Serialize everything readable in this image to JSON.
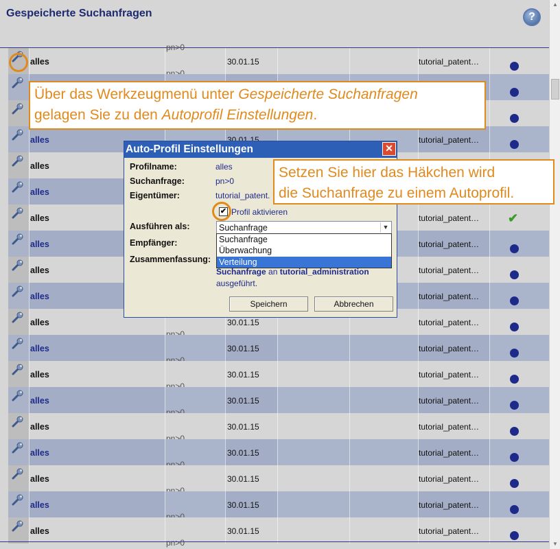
{
  "page": {
    "title": "Gespeicherte Suchanfragen",
    "help": "?"
  },
  "previous_row_fragment": "pn>0",
  "rows": [
    {
      "name": "alles",
      "query": "pn>0",
      "date": "30.01.15",
      "owner": "tutorial_patent…",
      "status": "dot"
    },
    {
      "name": "alles",
      "query": "pn>0",
      "date": "30.01.15",
      "owner": "tutorial_patent…",
      "status": "dot"
    },
    {
      "name": "alles",
      "query": "pn>0",
      "date": "30.01.15",
      "owner": "tutorial_patent…",
      "status": "dot"
    },
    {
      "name": "alles",
      "query": "pn>0",
      "date": "30.01.15",
      "owner": "tutorial_patent…",
      "status": "dot"
    },
    {
      "name": "alles",
      "query": "pn>0",
      "date": "30.01.15",
      "owner": "tutorial_patent…",
      "status": "dot"
    },
    {
      "name": "alles",
      "query": "pn>0",
      "date": "30.01.15",
      "owner": "tutorial_patent…",
      "status": "dot"
    },
    {
      "name": "alles",
      "query": "pn>0",
      "date": "30.01.15",
      "owner": "tutorial_patent…",
      "status": "check"
    },
    {
      "name": "alles",
      "query": "pn>0",
      "date": "30.01.15",
      "owner": "tutorial_patent…",
      "status": "dot"
    },
    {
      "name": "alles",
      "query": "pn>0",
      "date": "30.01.15",
      "owner": "tutorial_patent…",
      "status": "dot"
    },
    {
      "name": "alles",
      "query": "pn>0",
      "date": "30.01.15",
      "owner": "tutorial_patent…",
      "status": "dot"
    },
    {
      "name": "alles",
      "query": "pn>0",
      "date": "30.01.15",
      "owner": "tutorial_patent…",
      "status": "dot"
    },
    {
      "name": "alles",
      "query": "pn>0",
      "date": "30.01.15",
      "owner": "tutorial_patent…",
      "status": "dot"
    },
    {
      "name": "alles",
      "query": "pn>0",
      "date": "30.01.15",
      "owner": "tutorial_patent…",
      "status": "dot"
    },
    {
      "name": "alles",
      "query": "pn>0",
      "date": "30.01.15",
      "owner": "tutorial_patent…",
      "status": "dot"
    },
    {
      "name": "alles",
      "query": "pn>0",
      "date": "30.01.15",
      "owner": "tutorial_patent…",
      "status": "dot"
    },
    {
      "name": "alles",
      "query": "pn>0",
      "date": "30.01.15",
      "owner": "tutorial_patent…",
      "status": "dot"
    },
    {
      "name": "alles",
      "query": "pn>0",
      "date": "30.01.15",
      "owner": "tutorial_patent…",
      "status": "dot"
    },
    {
      "name": "alles",
      "query": "pn>0",
      "date": "30.01.15",
      "owner": "tutorial_patent…",
      "status": "dot"
    },
    {
      "name": "alles",
      "query": "pn>0",
      "date": "30.01.15",
      "owner": "tutorial_patent…",
      "status": "dot"
    }
  ],
  "callouts": {
    "toolmenu": {
      "part1": "Über das Werkzeugmenü unter ",
      "part2": "Gespeicherte Suchanfragen",
      "part3": "gelagen Sie zu den ",
      "part4": "Autoprofil Einstellungen",
      "part5": "."
    },
    "checkbox": {
      "line1": "Setzen Sie hier das Häkchen wird",
      "line2": "die Suchanfrage zu einem Autoprofil."
    }
  },
  "dialog": {
    "title": "Auto-Profil Einstellungen",
    "close": "✕",
    "fields": {
      "profilname_label": "Profilname:",
      "profilname_value": "alles",
      "suchanfrage_label": "Suchanfrage:",
      "suchanfrage_value": "pn>0",
      "eigentuemer_label": "Eigentümer:",
      "eigentuemer_value": "tutorial_patent.",
      "ausfuehren_label": "Ausführen als:",
      "empfaenger_label": "Empfänger:",
      "zusammenfassung_label": "Zusammenfassung:"
    },
    "checkbox": {
      "label": "Profil aktivieren",
      "checked": true,
      "mark": "✔"
    },
    "select": {
      "value": "Suchanfrage",
      "arrow": "▼",
      "options": [
        "Suchanfrage",
        "Überwachung",
        "Verteilung"
      ],
      "highlighted": "Verteilung"
    },
    "summary": {
      "bold1": "Suchanfrage",
      "mid": " an ",
      "bold2": "tutorial_administration",
      "end": "ausgeführt."
    },
    "buttons": {
      "save": "Speichern",
      "cancel": "Abbrechen"
    }
  },
  "colors": {
    "accent": "#e08a1e",
    "title_bar": "#2d5fb7",
    "status_dot": "#1e2a8a",
    "check": "#3a9a2a"
  }
}
